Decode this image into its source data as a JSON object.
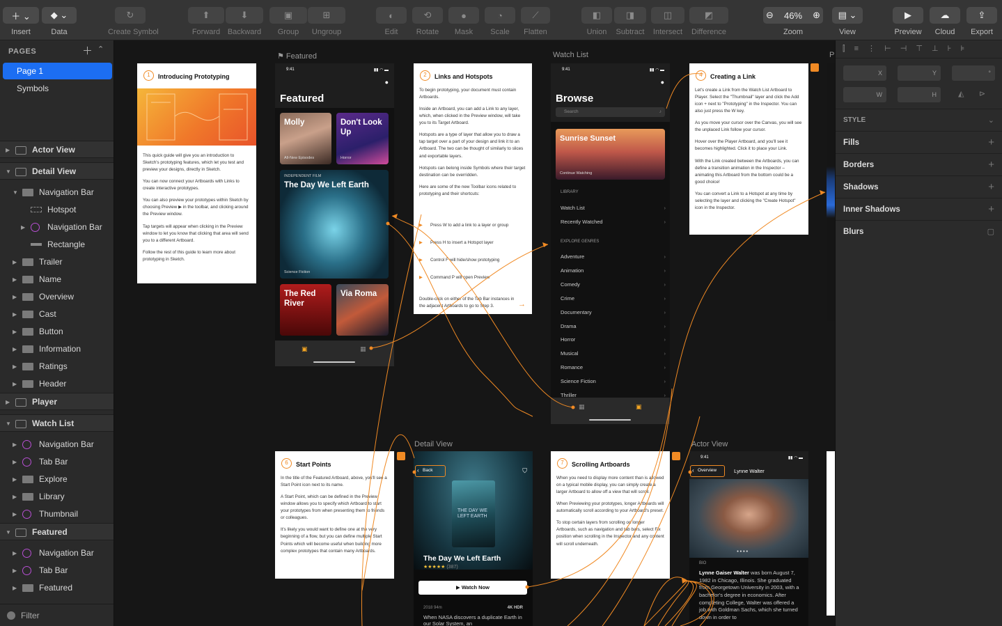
{
  "toolbar": {
    "insert": "Insert",
    "data": "Data",
    "create_symbol": "Create Symbol",
    "forward": "Forward",
    "backward": "Backward",
    "group": "Group",
    "ungroup": "Ungroup",
    "edit": "Edit",
    "rotate": "Rotate",
    "mask": "Mask",
    "scale": "Scale",
    "flatten": "Flatten",
    "union": "Union",
    "subtract": "Subtract",
    "intersect": "Intersect",
    "difference": "Difference",
    "zoom": "Zoom",
    "zoom_value": "46%",
    "view": "View",
    "preview": "Preview",
    "cloud": "Cloud",
    "export": "Export"
  },
  "sidebar": {
    "pages_header": "PAGES",
    "pages": [
      "Page 1",
      "Symbols"
    ],
    "layers": [
      {
        "label": "Actor View",
        "kind": "board",
        "depth": 0,
        "tri": "▶"
      },
      {
        "label": "Detail View",
        "kind": "board",
        "depth": 0,
        "tri": "▼"
      },
      {
        "label": "Navigation Bar",
        "kind": "folder",
        "depth": 1,
        "tri": "▼"
      },
      {
        "label": "Hotspot",
        "kind": "hot",
        "depth": 2,
        "tri": ""
      },
      {
        "label": "Navigation Bar",
        "kind": "sym",
        "depth": 2,
        "tri": "▶"
      },
      {
        "label": "Rectangle",
        "kind": "rect",
        "depth": 2,
        "tri": ""
      },
      {
        "label": "Trailer",
        "kind": "folder",
        "depth": 1,
        "tri": "▶"
      },
      {
        "label": "Name",
        "kind": "folder",
        "depth": 1,
        "tri": "▶"
      },
      {
        "label": "Overview",
        "kind": "folder",
        "depth": 1,
        "tri": "▶"
      },
      {
        "label": "Cast",
        "kind": "folder",
        "depth": 1,
        "tri": "▶"
      },
      {
        "label": "Button",
        "kind": "folder",
        "depth": 1,
        "tri": "▶"
      },
      {
        "label": "Information",
        "kind": "folder",
        "depth": 1,
        "tri": "▶"
      },
      {
        "label": "Ratings",
        "kind": "folder",
        "depth": 1,
        "tri": "▶"
      },
      {
        "label": "Header",
        "kind": "folder",
        "depth": 1,
        "tri": "▶"
      },
      {
        "label": "Player",
        "kind": "board",
        "depth": 0,
        "tri": "▶"
      },
      {
        "label": "Watch List",
        "kind": "board",
        "depth": 0,
        "tri": "▼"
      },
      {
        "label": "Navigation Bar",
        "kind": "sym",
        "depth": 1,
        "tri": "▶"
      },
      {
        "label": "Tab Bar",
        "kind": "sym",
        "depth": 1,
        "tri": "▶"
      },
      {
        "label": "Explore",
        "kind": "folder",
        "depth": 1,
        "tri": "▶"
      },
      {
        "label": "Library",
        "kind": "folder",
        "depth": 1,
        "tri": "▶"
      },
      {
        "label": "Thumbnail",
        "kind": "sym",
        "depth": 1,
        "tri": "▶"
      },
      {
        "label": "Featured",
        "kind": "board",
        "depth": 0,
        "tri": "▼"
      },
      {
        "label": "Navigation Bar",
        "kind": "sym",
        "depth": 1,
        "tri": "▶"
      },
      {
        "label": "Tab Bar",
        "kind": "sym",
        "depth": 1,
        "tri": "▶"
      },
      {
        "label": "Featured",
        "kind": "folder",
        "depth": 1,
        "tri": "▶"
      }
    ],
    "filter": "Filter"
  },
  "canvas": {
    "artboard_titles": {
      "featured": "Featured",
      "watch_list": "Watch List",
      "detail_view": "Detail View",
      "actor_view": "Actor View",
      "player": "P"
    },
    "card1": {
      "num": "1",
      "title": "Introducing Prototyping",
      "paras": [
        "This quick guide will give you an introduction to Sketch's prototyping features, which let you test and preview your designs, directly in Sketch.",
        "You can now connect your Artboards with Links to create interactive prototypes.",
        "You can also preview your prototypes within Sketch by choosing Preview ▶ in the toolbar, and clicking around the Preview window.",
        "Tap targets will appear when clicking in the Preview window to let you know that clicking that area will send you to a different Artboard.",
        "Follow the rest of this guide to learn more about prototyping in Sketch."
      ]
    },
    "card2": {
      "num": "2",
      "title": "Links and Hotspots",
      "paras": [
        "To begin prototyping, your document must contain Artboards.",
        "Inside an Artboard, you can add a Link to any layer, which, when clicked in the Preview window, will take you to its Target Artboard.",
        "Hotspots are a type of layer that allow you to draw a tap target over a part of your design and link it to an Artboard. The two can be thought of similarly to slices and exportable layers.",
        "Hotspots can belong inside Symbols where their target destination can be overridden.",
        "Here are some of the new Toolbar icons related to prototyping and their shortcuts:"
      ],
      "shortcuts": [
        "Press  W  to add a link to a layer or group",
        "Press  H  to insert a Hotspot layer",
        "Control  F  will hide/show prototyping",
        "Command  P  will open Preview"
      ],
      "footer": "Double-click on either of the Tab Bar instances in the adjacent Artboards to go to Step 3."
    },
    "card4": {
      "num": "4",
      "title": "Creating a Link",
      "paras": [
        "Let's create a Link from the Watch List Artboard to Player. Select the \"Thumbnail\" layer and click the Add icon + next to \"Prototyping\" in the Inspector. You can also just press the  W  key.",
        "As you move your cursor over the Canvas, you will see the unplaced Link follow your cursor.",
        "Hover over the Player Artboard, and you'll see it becomes highlighted. Click it to place your Link.",
        "With the Link created between the Artboards, you can define a transition animation in the Inspector – animating this Artboard from the bottom could be a good choice!",
        "You can convert a Link to a Hotspot at any time by selecting the layer and clicking the \"Create Hotspot\" icon in the Inspector."
      ]
    },
    "card6": {
      "num": "6",
      "title": "Start Points",
      "paras": [
        "In the title of the Featured Artboard, above, you'll see a Start Point icon next to its name.",
        "A Start Point, which can be defined in the Preview window allows you to specify which Artboard to start your prototypes from when presenting them to friends or colleagues.",
        "It's likely you would want to define one at the very beginning of a flow, but you can define multiple Start Points which will become useful when building more complex prototypes that contain many Artboards."
      ]
    },
    "card7": {
      "num": "7",
      "title": "Scrolling Artboards",
      "paras": [
        "When you need to display more content than is allowed on a typical mobile display, you can simply create a larger Artboard to allow off a view that will scroll.",
        "When Previewing your prototypes, longer Artboards will automatically scroll according to your Artboard's preset.",
        "To stop certain layers from scrolling on longer Artboards, such as navigation and tab bars, select Fix position when scrolling in the Inspector and any content will scroll underneath."
      ]
    },
    "featured": {
      "time": "9:41",
      "heading": "Featured",
      "tiles": [
        {
          "title": "Molly",
          "sub": "All-New Episodes"
        },
        {
          "title": "Don't Look Up",
          "sub": "Horror"
        },
        {
          "title": "The Day We Left Earth",
          "top": "INDEPENDENT FILM",
          "sub": "Science Fiction"
        },
        {
          "title": "The Red River",
          "sub": ""
        },
        {
          "title": "Via Roma",
          "sub": ""
        }
      ]
    },
    "browse": {
      "time": "9:41",
      "heading": "Browse",
      "search": "Search",
      "hero": "Sunrise Sunset",
      "hero_sub": "Continue Watching",
      "library_h": "LIBRARY",
      "library": [
        "Watch List",
        "Recently Watched"
      ],
      "explore_h": "EXPLORE GENRES",
      "genres": [
        "Adventure",
        "Animation",
        "Comedy",
        "Crime",
        "Documentary",
        "Drama",
        "Horror",
        "Musical",
        "Romance",
        "Science Fiction",
        "Thriller"
      ]
    },
    "detail": {
      "back": "Back",
      "poster": "THE DAY WE LEFT EARTH",
      "title": "The Day We Left Earth",
      "stars": "★★★★★",
      "count": "(387)",
      "watch": "Watch Now",
      "meta": "2018  94m",
      "badges": "4K  HDR",
      "desc": "When NASA discovers a duplicate Earth in our Solar System, an"
    },
    "actor": {
      "time": "9:41",
      "back": "Overview",
      "name": "Lynne Walter",
      "bio_h": "BIO",
      "bio_name": "Lynne Gaiser Walter",
      "bio": " was born August 7, 1982 in Chicago, Illinois. She graduated from Georgetown University in 2003, with a bachelor's degree in economics. After completing College, Walter was offered a job with Goldman Sachs, which she turned down in order to"
    }
  },
  "inspector": {
    "x": "X",
    "y": "Y",
    "rot": "°",
    "w": "W",
    "h": "H",
    "style": "STYLE",
    "rows": [
      "Fills",
      "Borders",
      "Shadows",
      "Inner Shadows",
      "Blurs"
    ]
  },
  "colors": {
    "accent": "#f08a24",
    "selection": "#1c6ef2",
    "symbol": "#b84fd4"
  }
}
